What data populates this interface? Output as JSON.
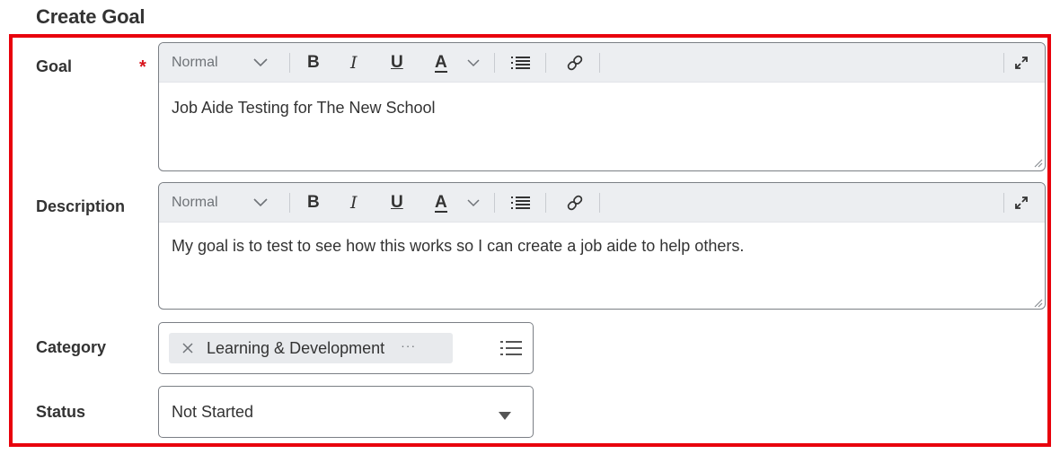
{
  "page": {
    "title": "Create Goal"
  },
  "colors": {
    "highlight": "#e8000c",
    "required": "#d8141c",
    "toolbar_bg": "#eceef1",
    "pill_bg": "#e8eaed"
  },
  "editor_toolbar": {
    "format_label": "Normal",
    "bold": "B",
    "italic": "I",
    "underline": "U",
    "font_color": "A",
    "icons": [
      "chevron-down-icon",
      "bulleted-list-icon",
      "link-icon",
      "expand-icon"
    ]
  },
  "form": {
    "goal": {
      "label": "Goal",
      "required_mark": "*",
      "value": "Job Aide Testing for The New School"
    },
    "description": {
      "label": "Description",
      "value": "My goal is to test to see how this works so I can create a job aide to help others."
    },
    "category": {
      "label": "Category",
      "selected": "Learning & Development",
      "more": "···"
    },
    "status": {
      "label": "Status",
      "value": "Not Started"
    }
  }
}
